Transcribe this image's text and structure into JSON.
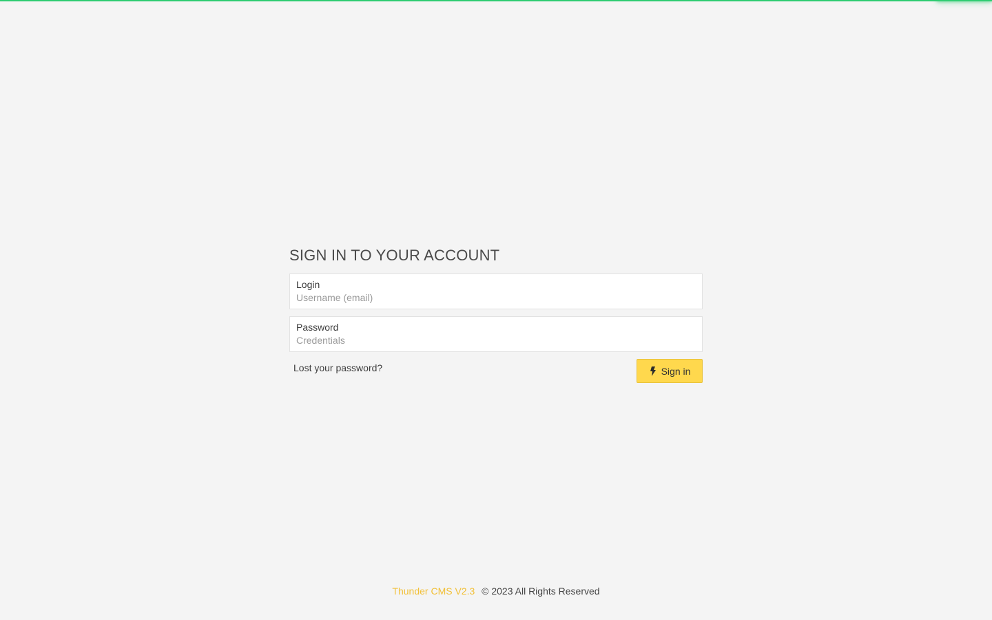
{
  "colors": {
    "background": "#f4f4f4",
    "progress": "#2ecc71",
    "accent": "#ffd84d",
    "brand": "#f2c037"
  },
  "progress": {
    "value_percent": 100
  },
  "login": {
    "title": "SIGN IN TO YOUR ACCOUNT",
    "username": {
      "label": "Login",
      "placeholder": "Username (email)",
      "value": ""
    },
    "password": {
      "label": "Password",
      "placeholder": "Credentials",
      "value": ""
    },
    "lost_password": "Lost your password?",
    "submit": {
      "label": "Sign in",
      "icon": "lightning-bolt-icon"
    }
  },
  "footer": {
    "brand": "Thunder CMS V2.3",
    "copyright": "© 2023 All Rights Reserved"
  }
}
